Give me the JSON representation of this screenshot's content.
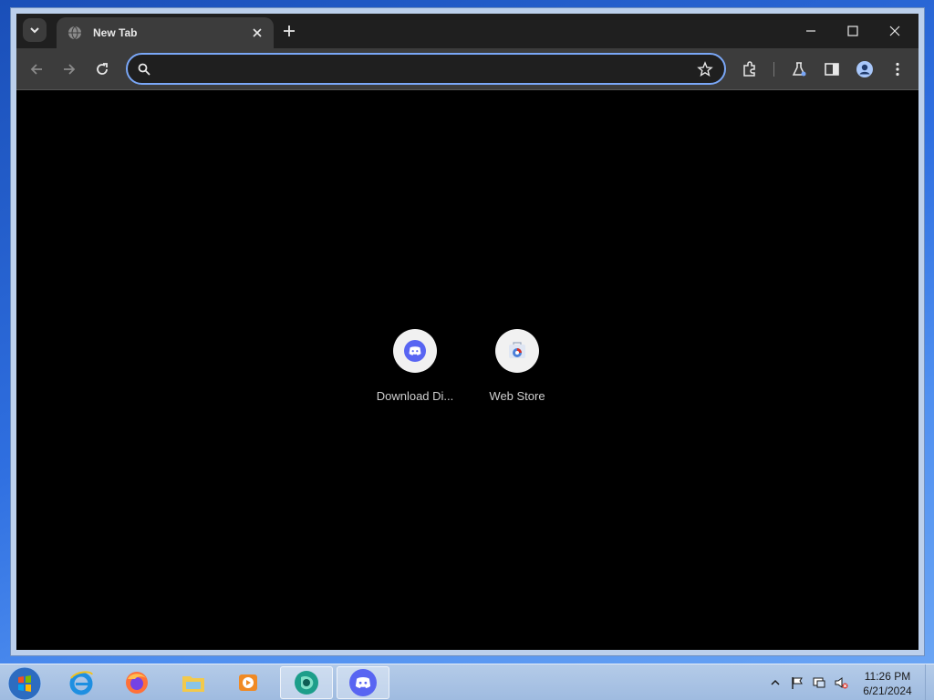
{
  "browser": {
    "tab": {
      "title": "New Tab"
    },
    "omnibox": {
      "value": "",
      "placeholder": ""
    },
    "shortcuts": [
      {
        "label": "Download Di...",
        "icon": "discord-icon"
      },
      {
        "label": "Web Store",
        "icon": "web-store-icon"
      }
    ]
  },
  "taskbar": {
    "apps": [
      "internet-explorer-icon",
      "firefox-icon",
      "file-explorer-icon",
      "media-player-icon",
      "browser-app-icon",
      "discord-icon"
    ],
    "clock": {
      "time": "11:26 PM",
      "date": "6/21/2024"
    }
  },
  "colors": {
    "discord": "#5865f2",
    "omnibox_focus": "#7aa7f7",
    "tabstrip": "#1f1f1f",
    "toolbar": "#3c3c3c"
  }
}
